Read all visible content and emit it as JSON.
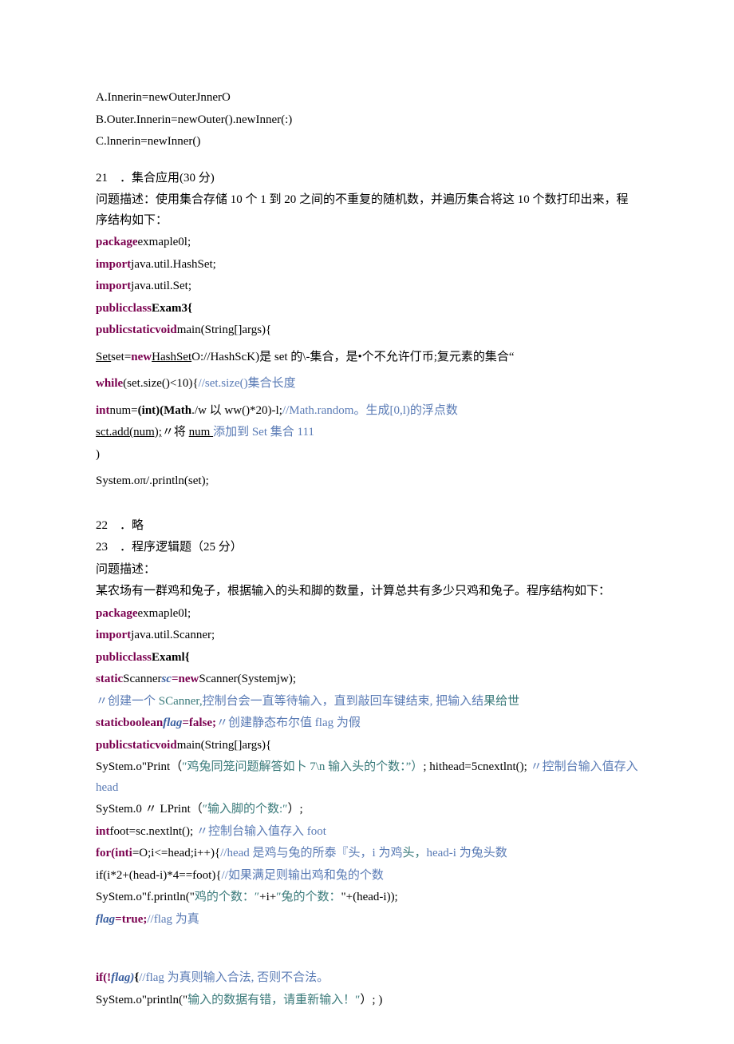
{
  "optA": "A.Innerin=newOuterJnnerO",
  "optB": "B.Outer.Innerin=newOuter().newInner(:)",
  "optC": "C.lnnerin=newInner()",
  "q21_num": "21　．集合应用(30 分)",
  "q21_desc": "问题描述：使用集合存储 10 个 1 到 20 之间的不重复的随机数，并遍历集合将这 10 个数打印出来，程序结构如下：",
  "q21_l1a": "package",
  "q21_l1b": "exmaple0l;",
  "q21_l2a": "import",
  "q21_l2b": "java.util.HashSet;",
  "q21_l3a": "import",
  "q21_l3b": "java.util.Set;",
  "q21_l4a": "publicclass",
  "q21_l4b": "Exam3{",
  "q21_l5a": "publicstaticvoid",
  "q21_l5b": "main(String[]args){",
  "q21_l6a": "Set",
  "q21_l6b": "set=",
  "q21_l6c": "new",
  "q21_l6d": "HashSet",
  "q21_l6e": "O://HashScK)是 set 的\\-集合，是•个不允许仃币;复元素的集合“",
  "q21_l7a": "while",
  "q21_l7b": "(set.size()<10){",
  "q21_l7c": "//set.size()集合长度",
  "q21_l8a": "int",
  "q21_l8b": "num=",
  "q21_l8c": "(int)(Math",
  "q21_l8d": "./w 以 ww()*20)-l;",
  "q21_l8e": "//Math.random。生成[0,l)的浮点数",
  "q21_l9a": "sct.add(num);",
  "q21_l9b": "〃将 ",
  "q21_l9c": "num ",
  "q21_l9d": "添加到 Set 集合 111",
  "q21_l10": ")",
  "q21_l11": "System.oπ/.println(set);",
  "q22": "22　．略",
  "q23_num": "23　．程序逻辑题（25 分）",
  "q23_desc1": "问题描述：",
  "q23_desc2": "某农场有一群鸡和兔子，根据输入的头和脚的数量，计算总共有多少只鸡和兔子。程序结构如下：",
  "q23_l1a": "package",
  "q23_l1b": "exmaple0l;",
  "q23_l2a": "import",
  "q23_l2b": "java.util.Scanner;",
  "q23_l3a": "publicclass",
  "q23_l3b": "Examl{",
  "q23_l4a": "static",
  "q23_l4b": "Scanner",
  "q23_l4c": "sc",
  "q23_l4d": "=new",
  "q23_l4e": "Scanner(Systemjw);",
  "q23_l5a": "〃创建一个 ",
  "q23_l5b": "SCanner,",
  "q23_l5c": "控制台会一直等待输入，直到敲回车键结束, 把输入结",
  "q23_l5d": "果给世",
  "q23_l6a": "staticboolean",
  "q23_l6b": "flag",
  "q23_l6c": "=false;",
  "q23_l6d": "〃创建静态布尔值 flag 为假",
  "q23_l7a": "publicstaticvoid",
  "q23_l7b": "main(String[]args){",
  "q23_l8a": "SyStem.o\"Print（",
  "q23_l8b": "″鸡兔同笼问题解答如卜 7\\n 输入头的个数：”）",
  "q23_l8c": "; hithead=5cnextlnt(); ",
  "q23_l8d": "〃控制台输入值存入 head",
  "q23_l9a": "SyStem.0 〃 LPrint（",
  "q23_l9b": "″输入脚的个数:″",
  "q23_l9c": "）;",
  "q23_l10a": "int",
  "q23_l10b": "foot=sc.nextlnt(); ",
  "q23_l10c": "〃控制台输入值存入 foot",
  "q23_l11a": "for(inti",
  "q23_l11b": "=O;i<=head;i++){",
  "q23_l11c": "//head 是鸡与兔的所泰『头，i 为鸡",
  "q23_l11d": "头，",
  "q23_l11e": "head-i 为兔头数",
  "q23_l12a": "if(i*2+(head-i)*4==foot){",
  "q23_l12b": "//如果满足则输出鸡和兔的个数",
  "q23_l13a": "SyStem.o\"f.println(\"",
  "q23_l13b": "鸡的个数：″",
  "q23_l13c": "+i+",
  "q23_l13d": "″兔的个数：",
  "q23_l13e": "\"+(head-i));",
  "q23_l14a": "flag",
  "q23_l14b": "=true;",
  "q23_l14c": "//flag 为真",
  "q23_l15a": "if(!",
  "q23_l15b": "flag)",
  "q23_l15c": "{",
  "q23_l15d": "//flag 为真则输入合法, 否则不合法。",
  "q23_l16a": "SyStem.o\"println(\"",
  "q23_l16b": "输入的数据有错，请重新输入！″",
  "q23_l16c": "）; )"
}
